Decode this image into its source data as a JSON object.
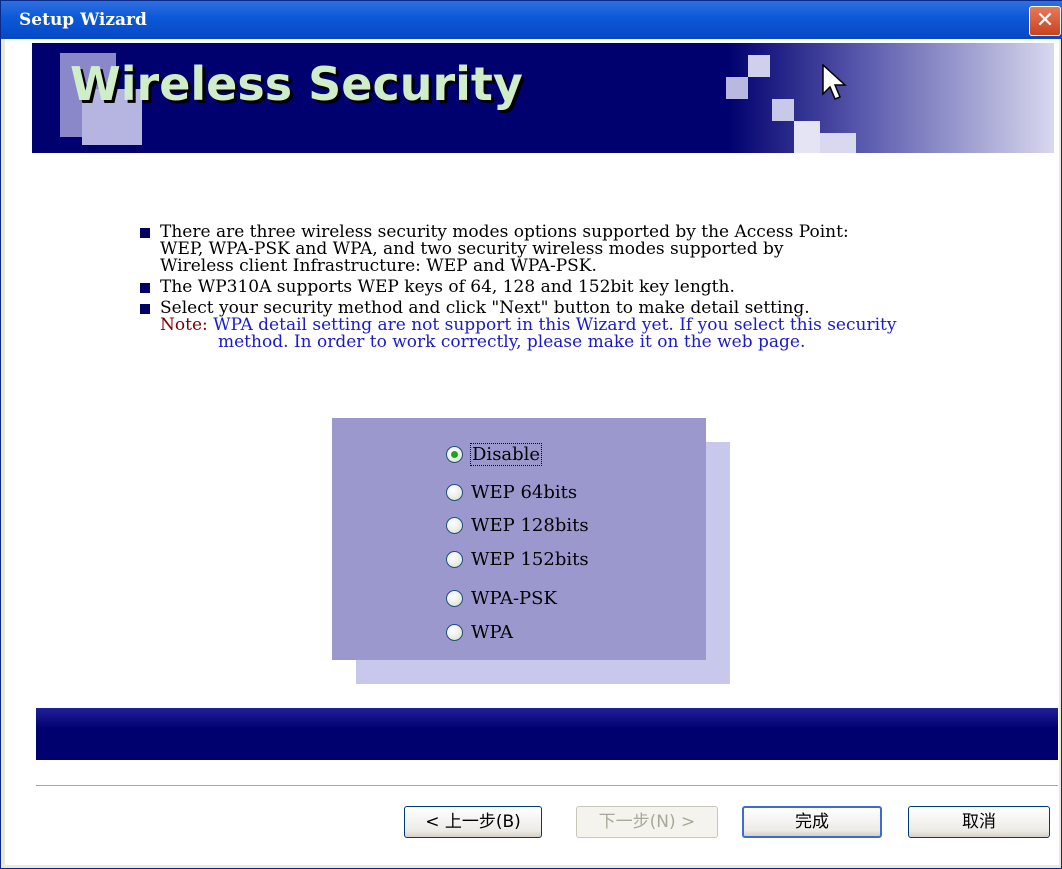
{
  "window": {
    "title": "Setup Wizard",
    "close_icon": "close-icon"
  },
  "banner": {
    "title": "Wireless Security"
  },
  "info": {
    "bullet1": [
      "There are three wireless security modes options supported by the Access Point:",
      "WEP, WPA-PSK and WPA, and two security wireless modes supported by",
      "Wireless client Infrastructure: WEP and WPA-PSK."
    ],
    "bullet2": "The WP310A supports WEP keys of 64, 128 and 152bit key length.",
    "bullet3": "Select your security method and click \"Next\" button to make detail setting.",
    "note_label": "Note:",
    "note_line1": "WPA detail setting are not support in this Wizard yet. If you select this security",
    "note_line2": "method. In order to work correctly, please make it on the web page."
  },
  "security_options": [
    {
      "label": "Disable",
      "selected": true
    },
    {
      "label": "WEP 64bits",
      "selected": false
    },
    {
      "label": "WEP 128bits",
      "selected": false
    },
    {
      "label": "WEP 152bits",
      "selected": false
    },
    {
      "label": "WPA-PSK",
      "selected": false
    },
    {
      "label": "WPA",
      "selected": false
    }
  ],
  "buttons": {
    "back": "< 上一步(B)",
    "next": "下一步(N) >",
    "finish": "完成",
    "cancel": "取消"
  },
  "colors": {
    "banner_navy": "#00006e",
    "panel": "#9a98cc",
    "panel_shadow": "#c8c8ec",
    "note_blue": "#1a1acc",
    "note_label": "#7a0000"
  }
}
